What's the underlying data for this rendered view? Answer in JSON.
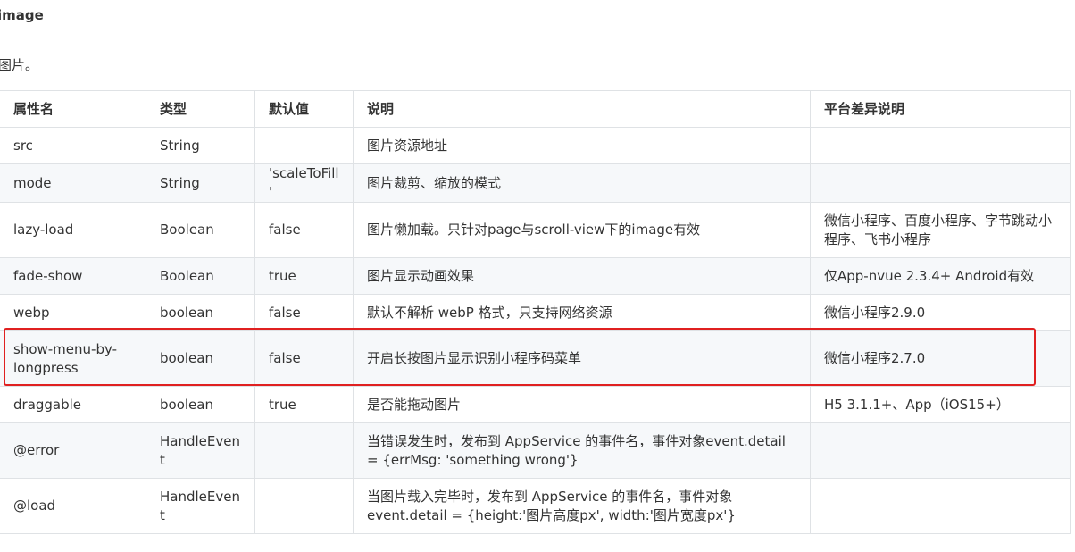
{
  "heading": "image",
  "description": "图片。",
  "table": {
    "headers": [
      "属性名",
      "类型",
      "默认值",
      "说明",
      "平台差异说明"
    ],
    "rows": [
      {
        "name": "src",
        "type": "String",
        "default": "",
        "desc": "图片资源地址",
        "platform": ""
      },
      {
        "name": "mode",
        "type": "String",
        "default": "'scaleToFill'",
        "desc": "图片裁剪、缩放的模式",
        "platform": ""
      },
      {
        "name": "lazy-load",
        "type": "Boolean",
        "default": "false",
        "desc": "图片懒加载。只针对page与scroll-view下的image有效",
        "platform": "微信小程序、百度小程序、字节跳动小程序、飞书小程序"
      },
      {
        "name": "fade-show",
        "type": "Boolean",
        "default": "true",
        "desc": "图片显示动画效果",
        "platform": "仅App-nvue 2.3.4+ Android有效"
      },
      {
        "name": "webp",
        "type": "boolean",
        "default": "false",
        "desc": "默认不解析 webP 格式，只支持网络资源",
        "platform": "微信小程序2.9.0"
      },
      {
        "name": "show-menu-by-longpress",
        "type": "boolean",
        "default": "false",
        "desc": "开启长按图片显示识别小程序码菜单",
        "platform": "微信小程序2.7.0"
      },
      {
        "name": "draggable",
        "type": "boolean",
        "default": "true",
        "desc": "是否能拖动图片",
        "platform": "H5 3.1.1+、App（iOS15+）"
      },
      {
        "name": "@error",
        "type": "HandleEvent",
        "default": "",
        "desc": "当错误发生时，发布到 AppService 的事件名，事件对象event.detail = {errMsg: 'something wrong'}",
        "platform": ""
      },
      {
        "name": "@load",
        "type": "HandleEvent",
        "default": "",
        "desc": "当图片载入完毕时，发布到 AppService 的事件名，事件对象event.detail = {height:'图片高度px', width:'图片宽度px'}",
        "platform": ""
      }
    ]
  },
  "colors": {
    "highlight_border": "#e02020",
    "table_border": "#dfe2e5",
    "stripe": "#f6f8fa"
  }
}
